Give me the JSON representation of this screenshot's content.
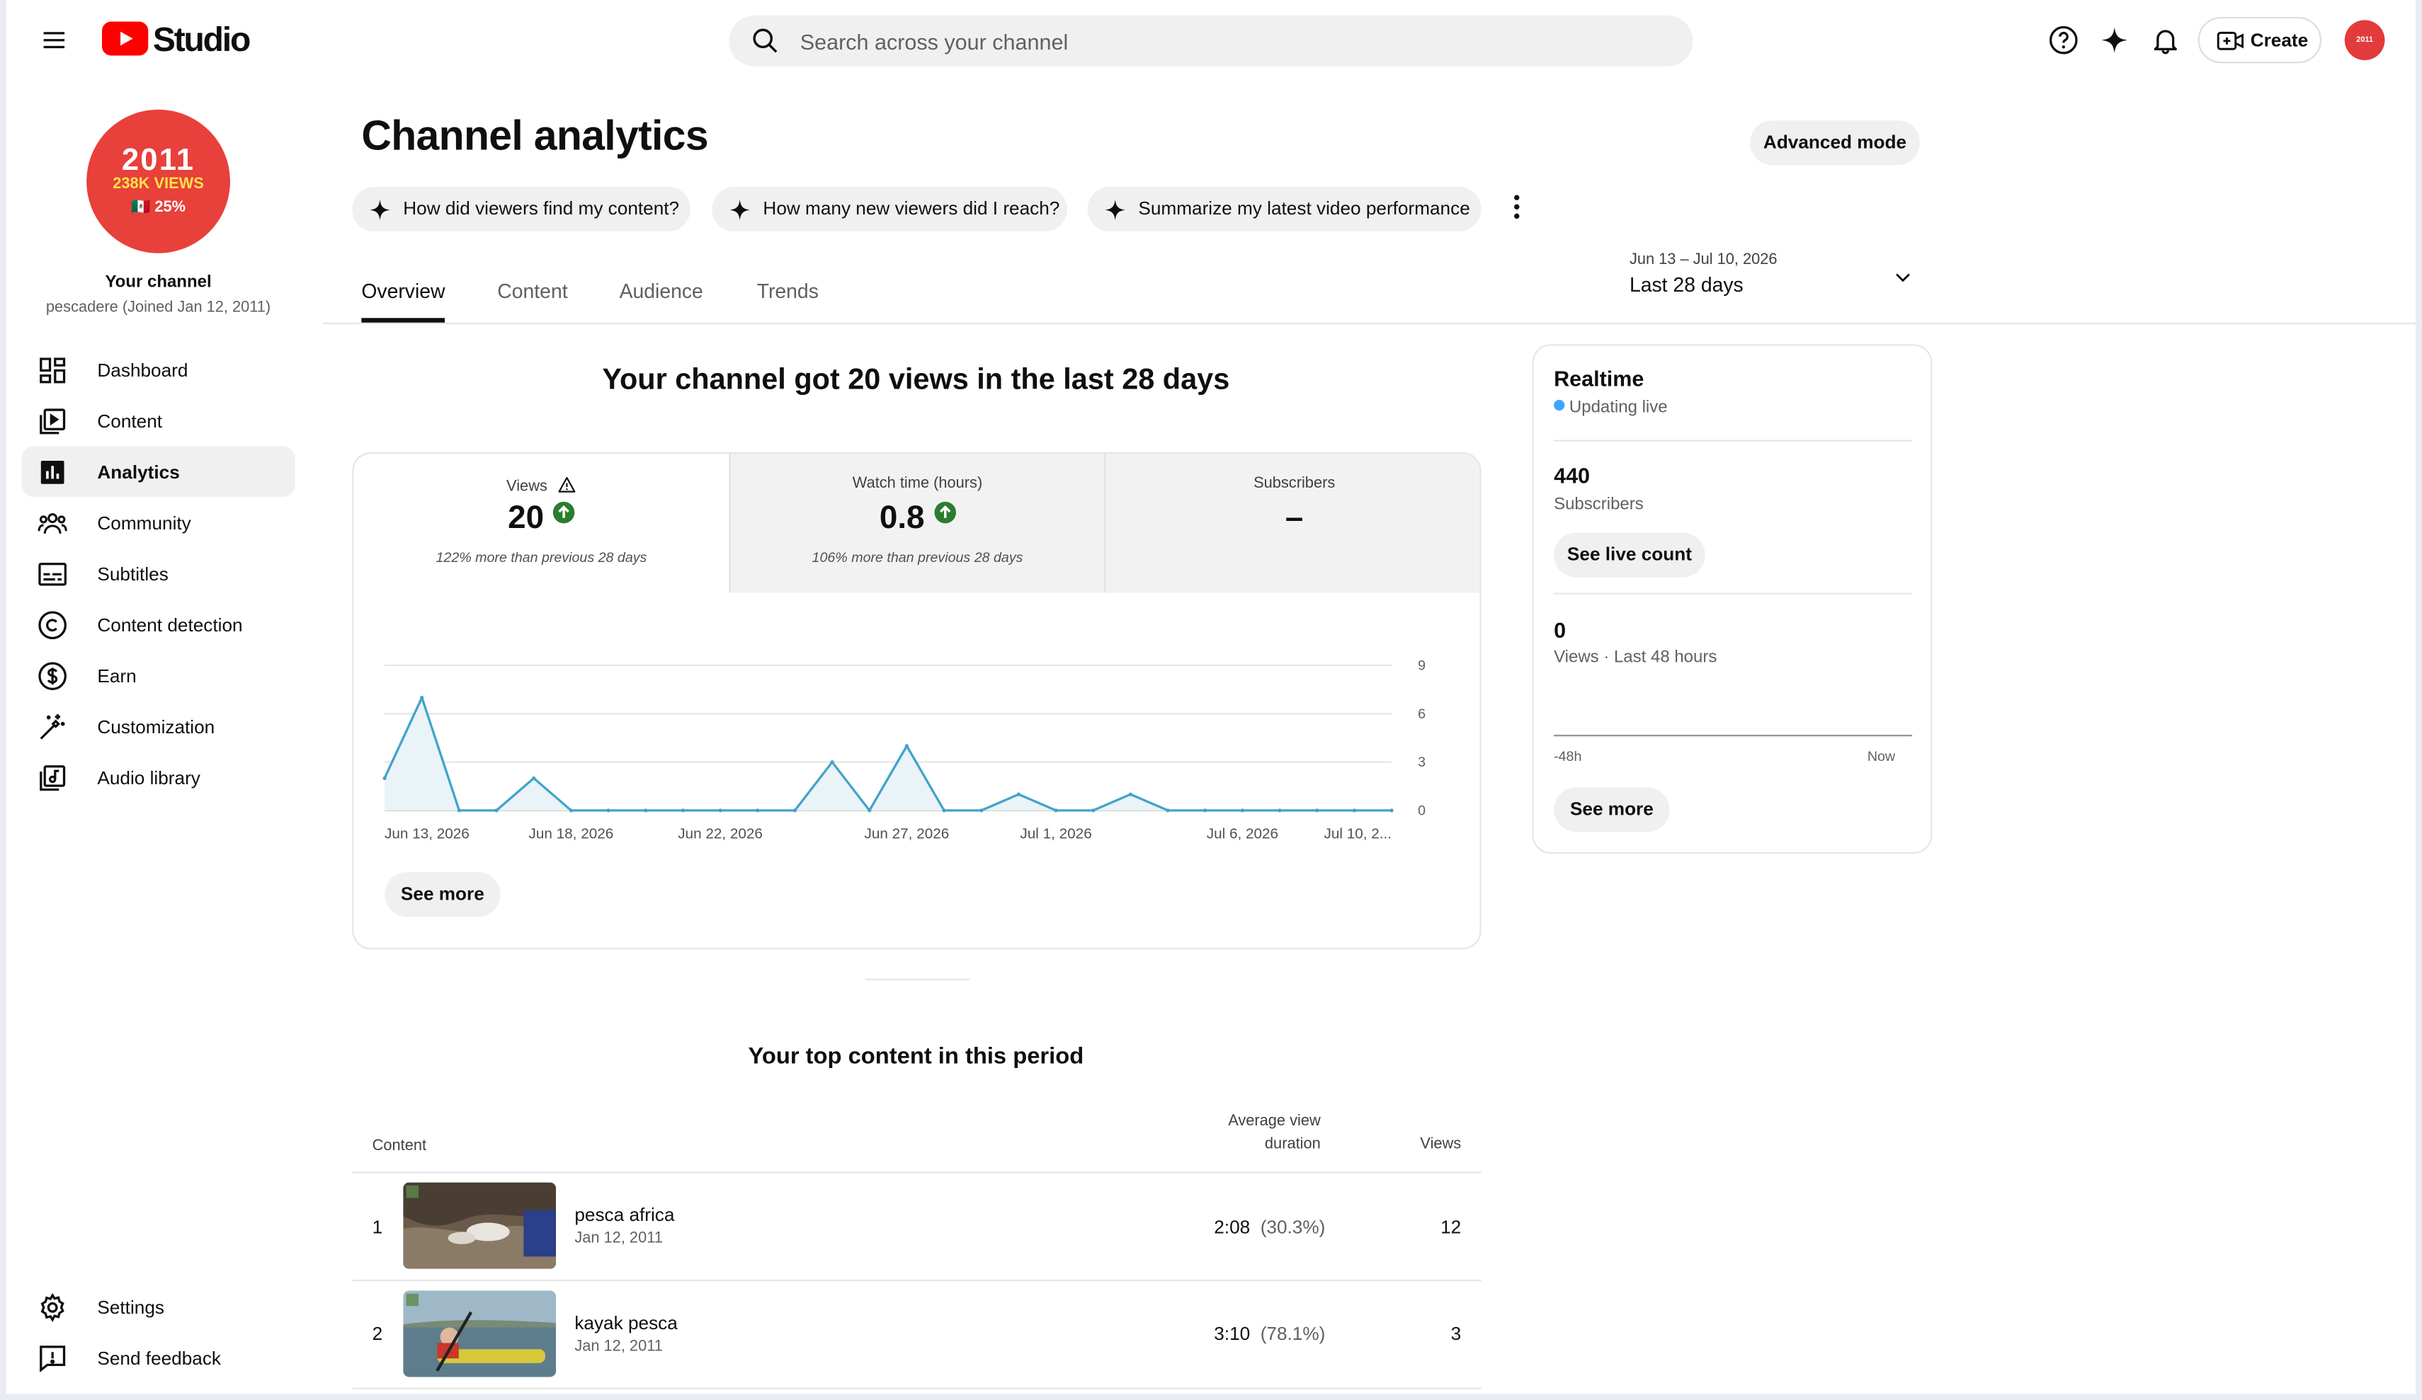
{
  "header": {
    "logo_text": "Studio",
    "search_placeholder": "Search across your channel",
    "create_label": "Create",
    "avatar_text": "2011"
  },
  "sidebar": {
    "channel_avatar": {
      "line1": "2011",
      "line2": "238K VIEWS",
      "line3": "🇲🇽 25%"
    },
    "your_channel": "Your channel",
    "channel_meta": "pescadere (Joined Jan 12, 2011)",
    "items": [
      {
        "label": "Dashboard",
        "icon": "dashboard-icon"
      },
      {
        "label": "Content",
        "icon": "content-icon"
      },
      {
        "label": "Analytics",
        "icon": "analytics-icon",
        "active": true
      },
      {
        "label": "Community",
        "icon": "community-icon"
      },
      {
        "label": "Subtitles",
        "icon": "subtitles-icon"
      },
      {
        "label": "Content detection",
        "icon": "copyright-icon"
      },
      {
        "label": "Earn",
        "icon": "dollar-icon"
      },
      {
        "label": "Customization",
        "icon": "magic-wand-icon"
      },
      {
        "label": "Audio library",
        "icon": "audio-library-icon"
      }
    ],
    "footer": [
      {
        "label": "Settings",
        "icon": "gear-icon"
      },
      {
        "label": "Send feedback",
        "icon": "feedback-icon"
      }
    ]
  },
  "page": {
    "title": "Channel analytics",
    "advanced_mode": "Advanced mode",
    "chips": [
      "How did viewers find my content?",
      "How many new viewers did I reach?",
      "Summarize my latest video performance"
    ],
    "tabs": [
      "Overview",
      "Content",
      "Audience",
      "Trends"
    ],
    "active_tab": "Overview",
    "date_range": "Jun 13 – Jul 10, 2026",
    "date_label": "Last 28 days"
  },
  "overview": {
    "headline": "Your channel got 20 views in the last 28 days",
    "metrics": [
      {
        "label": "Views",
        "value": "20",
        "comparison": "122% more than previous 28 days",
        "warning": true,
        "trend": "up"
      },
      {
        "label": "Watch time (hours)",
        "value": "0.8",
        "comparison": "106% more than previous 28 days",
        "trend": "up"
      },
      {
        "label": "Subscribers",
        "value": "–",
        "comparison": ""
      }
    ],
    "see_more": "See more"
  },
  "chart_data": {
    "type": "area",
    "x_tick_labels": [
      "Jun 13, 2026",
      "Jun 18, 2026",
      "Jun 22, 2026",
      "Jun 27, 2026",
      "Jul 1, 2026",
      "Jul 6, 2026",
      "Jul 10, 2..."
    ],
    "x": [
      "Jun 13",
      "Jun 14",
      "Jun 15",
      "Jun 16",
      "Jun 17",
      "Jun 18",
      "Jun 19",
      "Jun 20",
      "Jun 21",
      "Jun 22",
      "Jun 23",
      "Jun 24",
      "Jun 25",
      "Jun 26",
      "Jun 27",
      "Jun 28",
      "Jun 29",
      "Jun 30",
      "Jul 1",
      "Jul 2",
      "Jul 3",
      "Jul 4",
      "Jul 5",
      "Jul 6",
      "Jul 7",
      "Jul 8",
      "Jul 9",
      "Jul 10"
    ],
    "values": [
      2,
      7,
      0,
      0,
      2,
      0,
      0,
      0,
      0,
      0,
      0,
      0,
      3,
      0,
      4,
      0,
      0,
      1,
      0,
      0,
      1,
      0,
      0,
      0,
      0,
      0,
      0,
      0
    ],
    "y_ticks": [
      0,
      3,
      6,
      9
    ],
    "ylim": [
      0,
      9
    ],
    "grid": true,
    "color": "#41a3c9"
  },
  "realtime": {
    "title": "Realtime",
    "status": "Updating live",
    "subscribers_value": "440",
    "subscribers_label": "Subscribers",
    "see_live_count": "See live count",
    "views_value": "0",
    "views_label": "Views · Last 48 hours",
    "axis_start": "-48h",
    "axis_end": "Now",
    "see_more": "See more"
  },
  "top_content": {
    "title": "Your top content in this period",
    "col_content": "Content",
    "col_avd_line1": "Average view",
    "col_avd_line2": "duration",
    "col_views": "Views",
    "rows": [
      {
        "rank": "1",
        "title": "pesca africa",
        "date": "Jan 12, 2011",
        "avd": "2:08",
        "avd_pct": "(30.3%)",
        "views": "12"
      },
      {
        "rank": "2",
        "title": "kayak pesca",
        "date": "Jan 12, 2011",
        "avd": "3:10",
        "avd_pct": "(78.1%)",
        "views": "3"
      }
    ]
  }
}
